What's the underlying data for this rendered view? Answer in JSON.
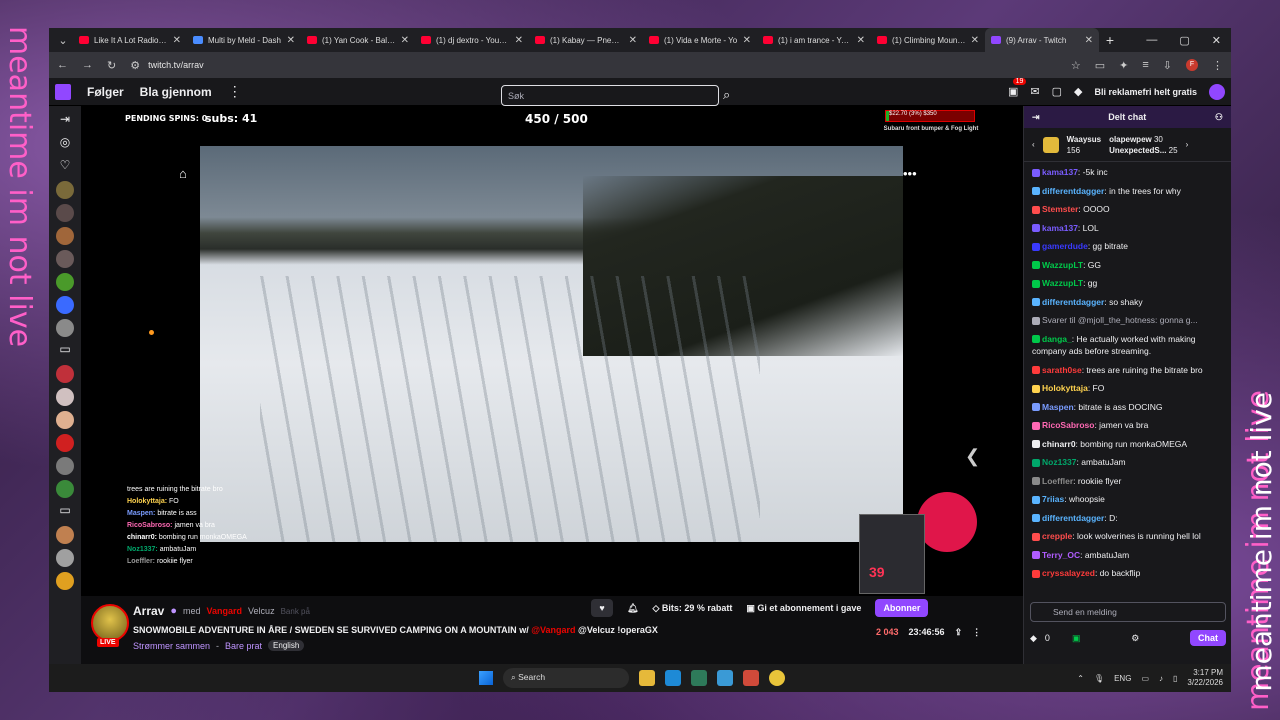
{
  "desktop": {
    "side_text": "meantime im not live"
  },
  "browser": {
    "tabs": [
      {
        "title": "Like It A Lot Radio - T",
        "type": "yt"
      },
      {
        "title": "Multi by Meld - Dash",
        "type": "meld"
      },
      {
        "title": "(1) Yan Cook - Balanc",
        "type": "yt"
      },
      {
        "title": "(1) dj dextro - YouTul",
        "type": "yt"
      },
      {
        "title": "(1) Kabay — Pneuma",
        "type": "yt"
      },
      {
        "title": "(1) Vida e Morte - Yo",
        "type": "yt"
      },
      {
        "title": "(1) i am trance - YouT",
        "type": "yt"
      },
      {
        "title": "(1) Climbing Mount E",
        "type": "yt"
      },
      {
        "title": "(9) Arrav - Twitch",
        "type": "twitch",
        "active": true
      }
    ],
    "url": "twitch.tv/arrav",
    "profile_initial": "F"
  },
  "twitch_nav": {
    "following": "Følger",
    "browse": "Bla gjennom",
    "search_placeholder": "Søk",
    "notif_count": "19",
    "adfree": "Bli reklamefri helt gratis"
  },
  "stream_overlay": {
    "pending_spins": "PENDING SPINS: 0",
    "subs": "subs: 41",
    "counter": "450 / 500",
    "goal_text": "$22.70 (3%) $350",
    "goal_fraction": 0.03,
    "goal_sub": "Subaru front bumper & Fog Light",
    "art_number": "39",
    "overlay_chat": [
      {
        "user": "",
        "text": "trees are ruining the bitrate bro",
        "color": "#ff4d4d"
      },
      {
        "user": "Holokyttaja:",
        "text": "FO",
        "color": "#ffd34f"
      },
      {
        "user": "Maspen:",
        "text": "bitrate is ass",
        "color": "#7a9cff"
      },
      {
        "user": "RicoSabroso:",
        "text": "jamen va bra",
        "color": "#ff69b4"
      },
      {
        "user": "chinarr0:",
        "text": "bombing run monkaOMEGA",
        "color": "#ffffff"
      },
      {
        "user": "Noz1337:",
        "text": "ambatuJam",
        "color": "#00a86b"
      },
      {
        "user": "Loeffler:",
        "text": "rookiie flyer",
        "color": "#999999"
      }
    ]
  },
  "stream_info": {
    "channel": "Arrav",
    "with_label": "med",
    "collab1": "Vangard",
    "collab2": "Velcuz",
    "collab3": "Bank på",
    "title_main": "SNOWMOBILE ADVENTURE IN ÅRE / SWEDEN SE SURVIVED CAMPING ON A MOUNTAIN",
    "title_w": "w/",
    "title_mention1": "@Vangard",
    "title_mention2": "@Velcuz",
    "title_tail": "!operaGX",
    "live": "LIVE",
    "category": "Strømmer sammen",
    "category2": "Bare prat",
    "language": "English",
    "bits": "Bits: 29 % rabatt",
    "gift": "Gi et abonnement i gave",
    "subscribe": "Abonner",
    "viewers": "2 043",
    "uptime": "23:46:56"
  },
  "chat": {
    "header": "Delt chat",
    "pinned": [
      {
        "user": "Waaysus",
        "count": "156"
      },
      {
        "user": "olapewpew",
        "count": "30"
      },
      {
        "user": "UnexpectedS...",
        "count": "25"
      }
    ],
    "messages": [
      {
        "user": "kama137",
        "text": ": -5k inc",
        "color": "#7a5cff"
      },
      {
        "user": "differentdagger",
        "text": ": in the trees for why",
        "color": "#5ab4ff"
      },
      {
        "user": "Stemster",
        "text": ": OOOO",
        "color": "#ff4d4d"
      },
      {
        "user": "kama137",
        "text": ": LOL",
        "color": "#7a5cff"
      },
      {
        "user": "gamerdude",
        "text": ": gg bitrate",
        "color": "#3a3aff"
      },
      {
        "user": "WazzupLT",
        "text": ": GG",
        "color": "#00c94a"
      },
      {
        "user": "WazzupLT",
        "text": ": gg",
        "color": "#00c94a"
      },
      {
        "user": "differentdagger",
        "text": ": so shaky",
        "color": "#5ab4ff"
      },
      {
        "user": "",
        "text": "Svarer til @mjoll_the_hotness: gonna g...",
        "color": "#adadb8"
      },
      {
        "user": "danga_",
        "text": ": He actually worked with making company ads before streaming.",
        "color": "#00c94a"
      },
      {
        "user": "sarath0se",
        "text": ": trees are ruining the bitrate bro",
        "color": "#ff3b3b"
      },
      {
        "user": "Holokyttaja",
        "text": ": FO",
        "color": "#ffd34f"
      },
      {
        "user": "Maspen",
        "text": ": bitrate is ass DOCING",
        "color": "#7a9cff"
      },
      {
        "user": "RicoSabroso",
        "text": ": jamen va bra",
        "color": "#ff69b4"
      },
      {
        "user": "chinarr0",
        "text": ": bombing run monkaOMEGA",
        "color": "#efeff1"
      },
      {
        "user": "Noz1337",
        "text": ": ambatuJam",
        "color": "#00a86b"
      },
      {
        "user": "Loeffler",
        "text": ": rookiie flyer",
        "color": "#8a8a8a"
      },
      {
        "user": "7riias",
        "text": ": whoopsie",
        "color": "#5ab4ff"
      },
      {
        "user": "differentdagger",
        "text": ": D:",
        "color": "#5ab4ff"
      },
      {
        "user": "crepple",
        "text": ": look wolverines is running hell lol",
        "color": "#ff4d4d"
      },
      {
        "user": "Terry_OC",
        "text": ": ambatuJam",
        "color": "#b05cff"
      },
      {
        "user": "cryssalayzed",
        "text": ": do backflip",
        "color": "#ff3b3b"
      }
    ],
    "input_placeholder": "Send en melding",
    "points": "0",
    "chat_button": "Chat"
  },
  "taskbar": {
    "search": "Search",
    "lang": "ENG",
    "time": "3:17 PM",
    "date": "3/22/2026"
  }
}
